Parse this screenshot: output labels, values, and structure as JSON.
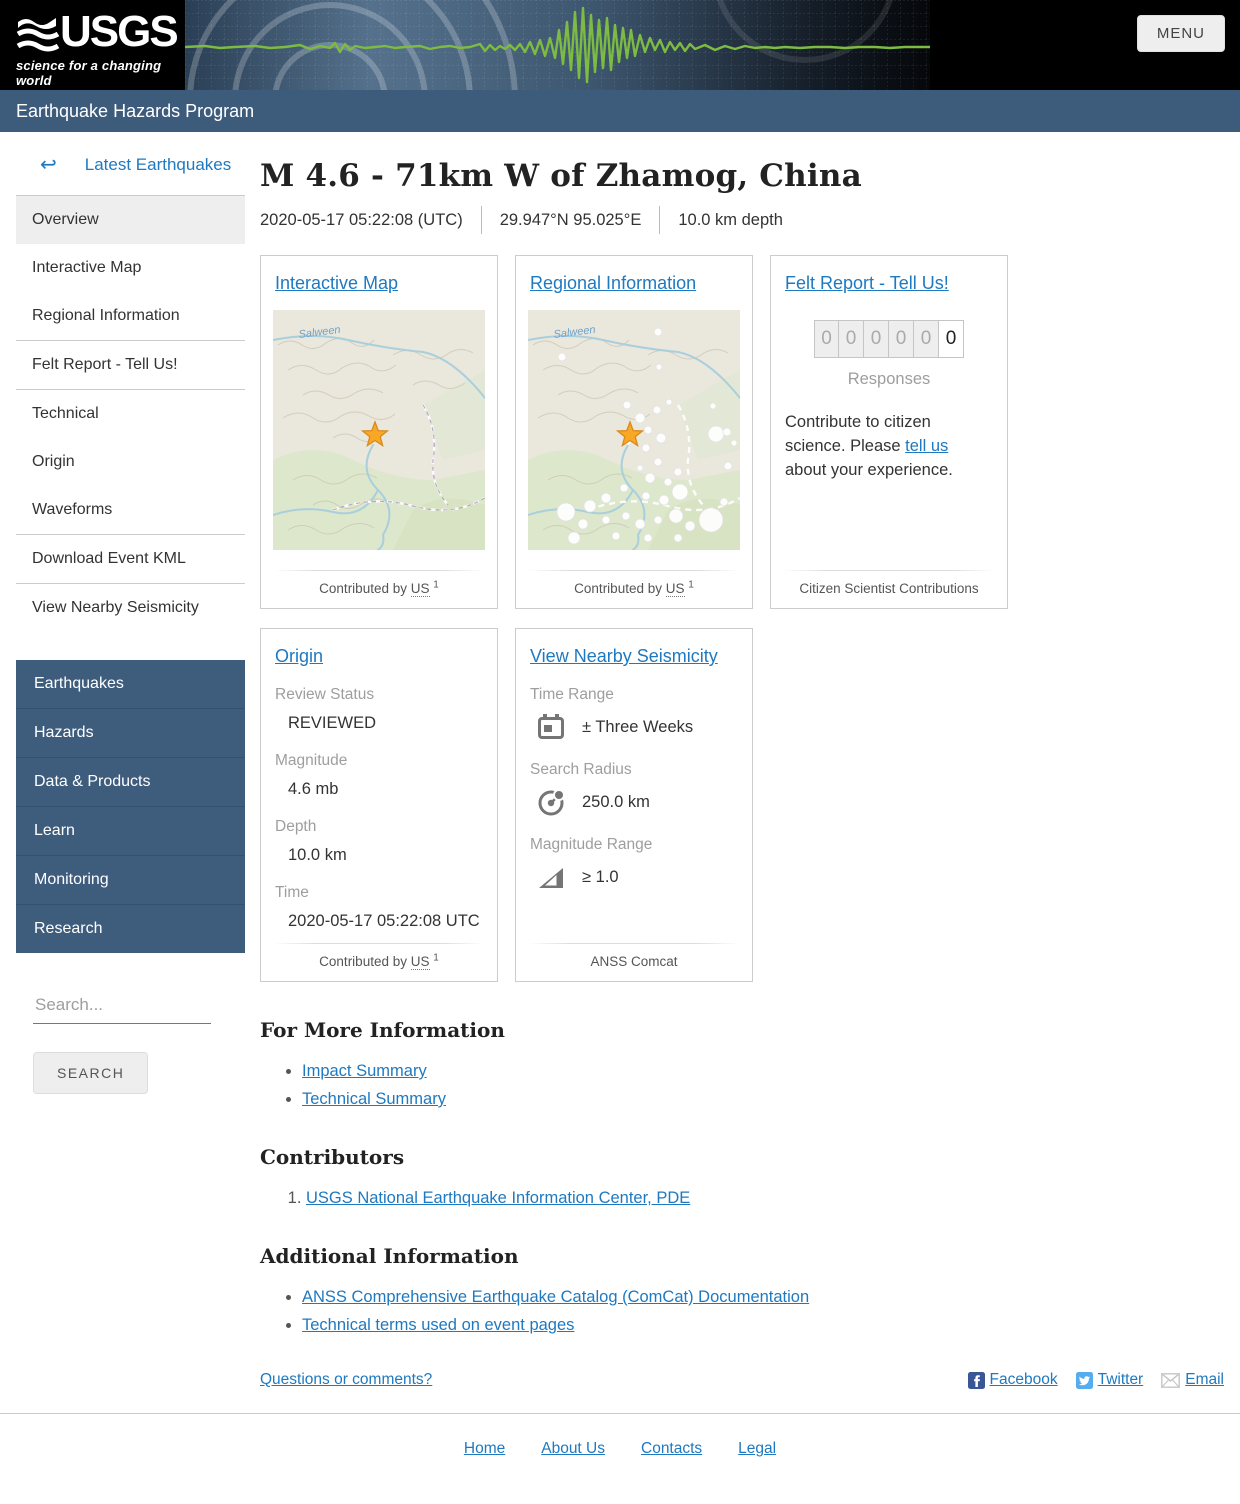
{
  "header": {
    "logo_title": "USGS",
    "logo_tagline": "science for a changing world",
    "menu_label": "MENU",
    "program_title": "Earthquake Hazards Program"
  },
  "event": {
    "title": "M 4.6 - 71km W of Zhamog, China",
    "datetime": "2020-05-17 05:22:08 (UTC)",
    "coordinates": "29.947°N 95.025°E",
    "depth": "10.0 km depth"
  },
  "sidebar": {
    "back_arrow": "↩",
    "back_label": "Latest Earthquakes",
    "items": [
      {
        "label": "Overview"
      },
      {
        "label": "Interactive Map"
      },
      {
        "label": "Regional Information"
      },
      {
        "label": "Felt Report - Tell Us!"
      },
      {
        "label": "Technical"
      },
      {
        "label": "Origin"
      },
      {
        "label": "Waveforms"
      },
      {
        "label": "Download Event KML"
      },
      {
        "label": "View Nearby Seismicity"
      }
    ],
    "menu": [
      {
        "label": "Earthquakes"
      },
      {
        "label": "Hazards"
      },
      {
        "label": "Data & Products"
      },
      {
        "label": "Learn"
      },
      {
        "label": "Monitoring"
      },
      {
        "label": "Research"
      }
    ],
    "search_placeholder": "Search...",
    "search_button": "SEARCH"
  },
  "cards": {
    "interactive_map": {
      "title": "Interactive Map",
      "map_river_label": "Salween",
      "footer_prefix": "Contributed by ",
      "footer_code": "US",
      "footer_sup": "1"
    },
    "regional_info": {
      "title": "Regional Information",
      "map_river_label": "Salween",
      "footer_prefix": "Contributed by ",
      "footer_code": "US",
      "footer_sup": "1"
    },
    "felt_report": {
      "title": "Felt Report - Tell Us!",
      "digits": [
        "0",
        "0",
        "0",
        "0",
        "0",
        "0"
      ],
      "responses_label": "Responses",
      "text_before": "Contribute to citizen science. Please ",
      "text_link": "tell us",
      "text_after": " about your experience.",
      "footer": "Citizen Scientist Contributions"
    },
    "origin": {
      "title": "Origin",
      "fields": [
        {
          "label": "Review Status",
          "value": "REVIEWED"
        },
        {
          "label": "Magnitude",
          "value": "4.6 mb"
        },
        {
          "label": "Depth",
          "value": "10.0 km"
        },
        {
          "label": "Time",
          "value": "2020-05-17 05:22:08 UTC"
        }
      ],
      "footer_prefix": "Contributed by ",
      "footer_code": "US",
      "footer_sup": "1"
    },
    "nearby_seismicity": {
      "title": "View Nearby Seismicity",
      "fields": [
        {
          "label": "Time Range",
          "icon": "calendar-icon",
          "value": "± Three Weeks"
        },
        {
          "label": "Search Radius",
          "icon": "radius-icon",
          "value": "250.0 km"
        },
        {
          "label": "Magnitude Range",
          "icon": "magnitude-icon",
          "value": "≥ 1.0"
        }
      ],
      "footer": "ANSS Comcat"
    }
  },
  "sections": {
    "more_info": {
      "heading": "For More Information",
      "links": [
        {
          "label": "Impact Summary"
        },
        {
          "label": "Technical Summary"
        }
      ]
    },
    "contributors": {
      "heading": "Contributors",
      "links": [
        {
          "label": "USGS National Earthquake Information Center, PDE"
        }
      ]
    },
    "additional": {
      "heading": "Additional Information",
      "links": [
        {
          "label": "ANSS Comprehensive Earthquake Catalog (ComCat) Documentation"
        },
        {
          "label": "Technical terms used on event pages"
        }
      ]
    }
  },
  "feedback": {
    "question_link": "Questions or comments?",
    "social": [
      {
        "label": "Facebook"
      },
      {
        "label": "Twitter"
      },
      {
        "label": "Email"
      }
    ]
  },
  "footer": {
    "links": [
      {
        "label": "Home"
      },
      {
        "label": "About Us"
      },
      {
        "label": "Contacts"
      },
      {
        "label": "Legal"
      }
    ]
  },
  "colors": {
    "link_blue": "#1e79c0",
    "nav_blue": "#3e5d7d",
    "program_bar_blue": "#3d5c7c",
    "waveform_green": "#7dbb42",
    "star_orange": "#f9a825"
  }
}
